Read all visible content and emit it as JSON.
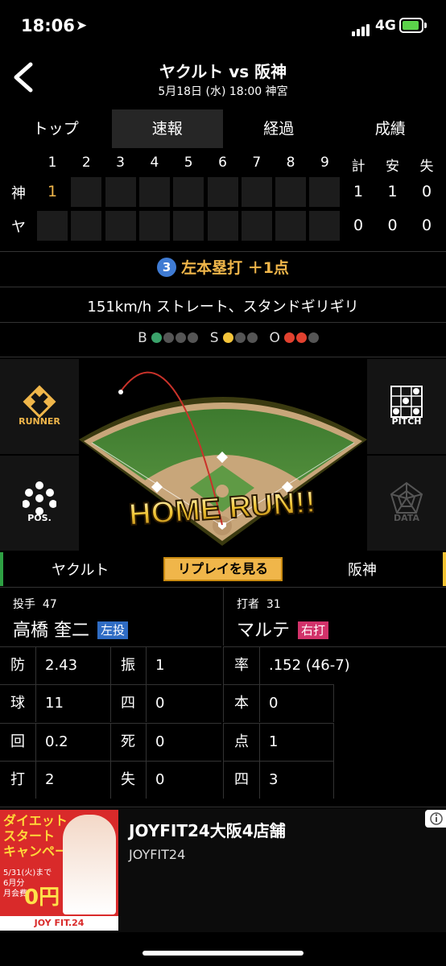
{
  "status": {
    "time": "18:06",
    "network": "4G"
  },
  "header": {
    "title": "ヤクルト vs 阪神",
    "subtitle": "5月18日 (水) 18:00 神宮"
  },
  "tabs": [
    {
      "label": "トップ",
      "active": false
    },
    {
      "label": "速報",
      "active": true
    },
    {
      "label": "経過",
      "active": false
    },
    {
      "label": "成績",
      "active": false
    }
  ],
  "linescore": {
    "innings": [
      "1",
      "2",
      "3",
      "4",
      "5",
      "6",
      "7",
      "8",
      "9"
    ],
    "totals_headers": [
      "計",
      "安",
      "失"
    ],
    "teams": [
      {
        "abbr": "神",
        "innings": [
          "1",
          "",
          "",
          "",
          "",
          "",
          "",
          "",
          ""
        ],
        "totals": [
          "1",
          "1",
          "0"
        ]
      },
      {
        "abbr": "ヤ",
        "innings": [
          "",
          "",
          "",
          "",
          "",
          "",
          "",
          "",
          ""
        ],
        "totals": [
          "0",
          "0",
          "0"
        ]
      }
    ]
  },
  "play": {
    "number": "3",
    "result": "左本塁打 ＋1点",
    "description": "151km/h ストレート、スタンドギリギリ"
  },
  "count": {
    "balls": {
      "label": "B",
      "lit": 1,
      "total": 4,
      "color": "#3aa36b"
    },
    "strikes": {
      "label": "S",
      "lit": 1,
      "total": 3,
      "color": "#f5c53a"
    },
    "outs": {
      "label": "O",
      "lit": 2,
      "total": 3,
      "color": "#e2412f"
    }
  },
  "side_buttons": {
    "runner": "RUNNER",
    "pos": "POS.",
    "pitch": "PITCH",
    "data": "DATA"
  },
  "field_banner": "HOME RUN!!",
  "teambar": {
    "left": "ヤクルト",
    "replay": "リプレイを見る",
    "right": "阪神"
  },
  "pitcher": {
    "role": "投手",
    "number": "47",
    "name": "高橋 奎二",
    "hand": "左投",
    "hand_color": "#2f6cc4",
    "stats": [
      {
        "k": "防",
        "v": "2.43"
      },
      {
        "k": "振",
        "v": "1"
      },
      {
        "k": "球",
        "v": "11"
      },
      {
        "k": "四",
        "v": "0"
      },
      {
        "k": "回",
        "v": "0.2"
      },
      {
        "k": "死",
        "v": "0"
      },
      {
        "k": "打",
        "v": "2"
      },
      {
        "k": "失",
        "v": "0"
      }
    ]
  },
  "batter": {
    "role": "打者",
    "number": "31",
    "name": "マルテ",
    "hand": "右打",
    "hand_color": "#d2326a",
    "stats": [
      {
        "k": "率",
        "v": ".152 (46-7)"
      },
      {
        "k": "本",
        "v": "0"
      },
      {
        "k": "点",
        "v": "1"
      },
      {
        "k": "四",
        "v": "3"
      }
    ]
  },
  "ad": {
    "title": "JOYFIT24大阪4店舗",
    "sponsor": "JOYFIT24",
    "image_text": "ダイエット\nスタート\nキャンペーン",
    "image_price": "0円",
    "image_note": "5/31(火)まで\n6月分\n月会費",
    "image_brand": "JOY FIT.24"
  }
}
